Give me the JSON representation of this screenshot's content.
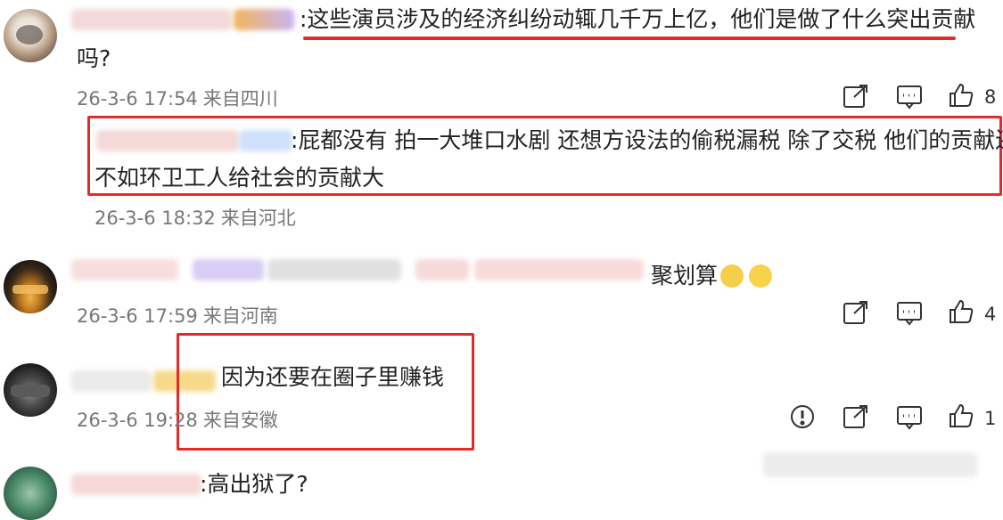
{
  "comments": [
    {
      "text_line1": ":这些演员涉及的经济纠纷动辄几千万上亿，他们是做了什么突出贡献",
      "text_line2": "吗?",
      "date": "26-3-6 17:54",
      "location": "来自四川",
      "likes": "8"
    },
    {
      "reply": true,
      "text_line1": ":屁都没有 拍一大堆口水剧 还想方设法的偷税漏税 除了交税 他们的贡献还",
      "text_line2": "不如环卫工人给社会的贡献大",
      "date": "26-3-6 18:32",
      "location": "来自河北"
    },
    {
      "text": "聚划算",
      "date": "26-3-6 17:59",
      "location": "来自河南",
      "likes": "4"
    },
    {
      "text": "因为还要在圈子里赚钱",
      "date": "26-3-6 19:28",
      "location": "来自安徽",
      "likes": "1"
    },
    {
      "text": ":高出狱了?"
    }
  ],
  "icons": {
    "share": "share-icon",
    "comment": "comment-icon",
    "like": "thumbs-up-icon",
    "report": "report-icon"
  },
  "colors": {
    "highlight": "#e52a2a",
    "meta": "#777777"
  }
}
